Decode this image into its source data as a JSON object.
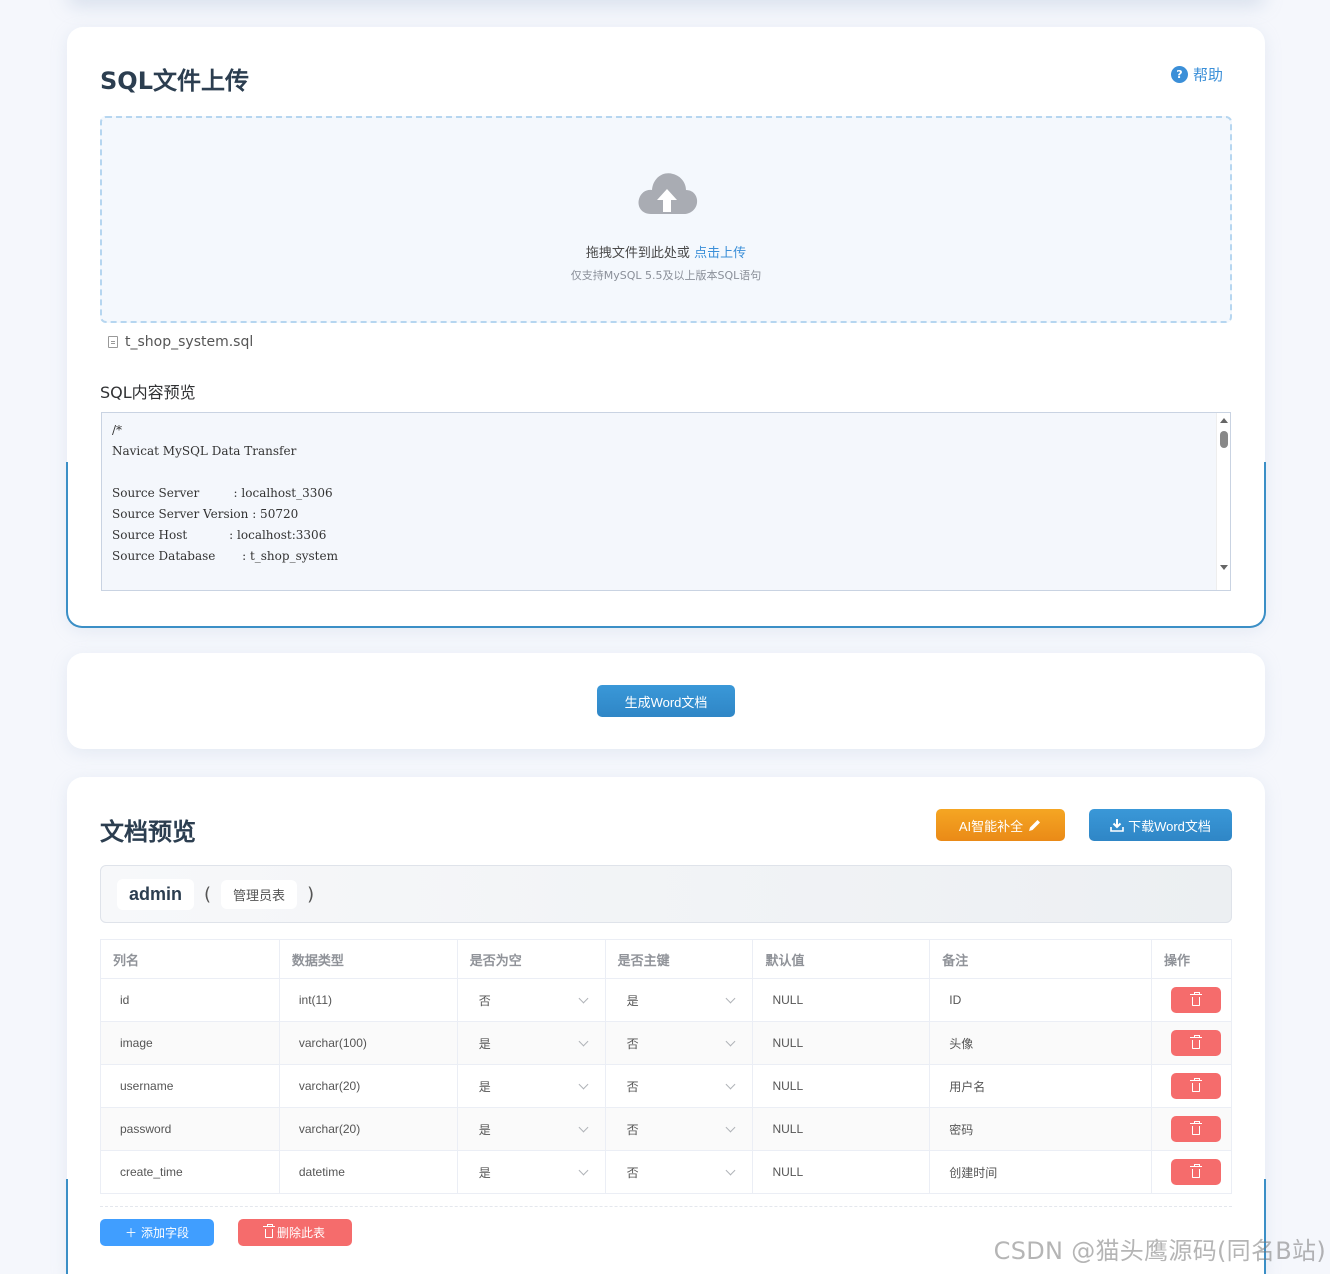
{
  "upload": {
    "title": "SQL文件上传",
    "help_label": "帮助",
    "help_icon": "question-circle-icon",
    "drop_text": "拖拽文件到此处或",
    "drop_link": "点击上传",
    "drop_tip": "仅支持MySQL 5.5及以上版本SQL语句",
    "file_name": "t_shop_system.sql",
    "preview_label": "SQL内容预览",
    "sql_content": "/*\nNavicat MySQL Data Transfer\n\nSource Server         : localhost_3306\nSource Server Version : 50720\nSource Host           : localhost:3306\nSource Database       : t_shop_system"
  },
  "actions": {
    "generate_label": "生成Word文档"
  },
  "preview": {
    "title": "文档预览",
    "ai_label": "AI智能补全",
    "download_label": "下载Word文档",
    "table_name": "admin",
    "paren_open": "(",
    "paren_close": ")",
    "table_comment": "管理员表",
    "columns": [
      "列名",
      "数据类型",
      "是否为空",
      "是否主键",
      "默认值",
      "备注",
      "操作"
    ],
    "rows": [
      {
        "name": "id",
        "type": "int(11)",
        "nullable": "否",
        "primary": "是",
        "default": "NULL",
        "comment": "ID"
      },
      {
        "name": "image",
        "type": "varchar(100)",
        "nullable": "是",
        "primary": "否",
        "default": "NULL",
        "comment": "头像"
      },
      {
        "name": "username",
        "type": "varchar(20)",
        "nullable": "是",
        "primary": "否",
        "default": "NULL",
        "comment": "用户名"
      },
      {
        "name": "password",
        "type": "varchar(20)",
        "nullable": "是",
        "primary": "否",
        "default": "NULL",
        "comment": "密码"
      },
      {
        "name": "create_time",
        "type": "datetime",
        "nullable": "是",
        "primary": "否",
        "default": "NULL",
        "comment": "创建时间"
      }
    ],
    "add_field_label": "添加字段",
    "delete_table_label": "删除此表"
  },
  "watermark": "CSDN @猫头鹰源码(同名B站)",
  "colors": {
    "accent_blue": "#3b8fd8",
    "button_blue": "#2f86c6",
    "ai_orange": "#f5a623",
    "danger": "#f56c6c",
    "primary": "#409eff"
  }
}
